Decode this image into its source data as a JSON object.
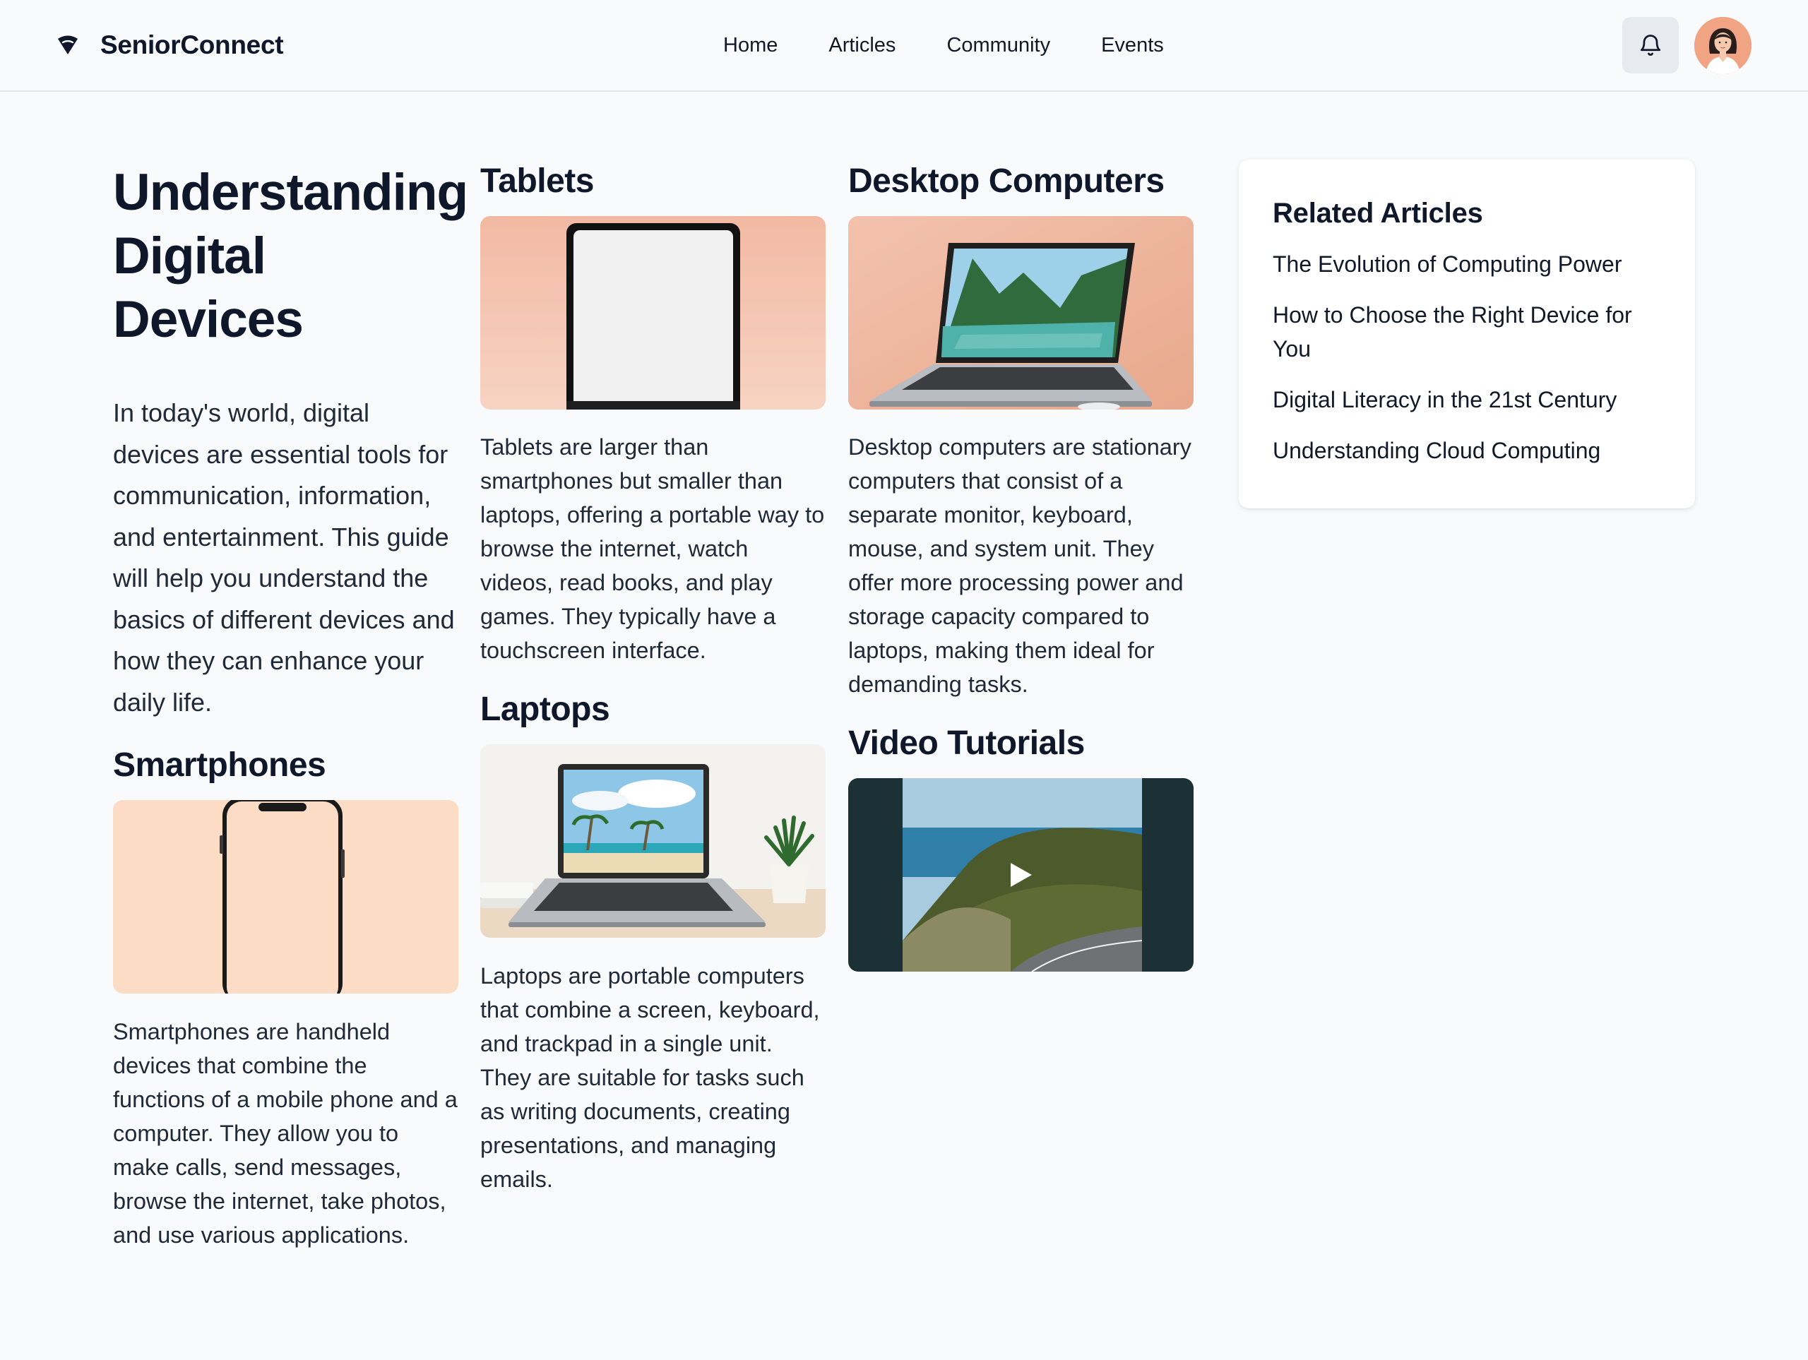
{
  "brand": {
    "name": "SeniorConnect",
    "logo_icon": "wifi-signal-icon"
  },
  "nav": {
    "items": [
      {
        "label": "Home"
      },
      {
        "label": "Articles"
      },
      {
        "label": "Community"
      },
      {
        "label": "Events"
      }
    ]
  },
  "header_actions": {
    "notifications_icon": "bell-icon",
    "avatar_icon": "user-avatar"
  },
  "intro": {
    "title": "Understanding Digital Devices",
    "text": "In today's world, digital devices are essential tools for communication, information, and entertainment. This guide will help you understand the basics of different devices and how they can enhance your daily life."
  },
  "sections": {
    "smartphones": {
      "title": "Smartphones",
      "description": "Smartphones are handheld devices that combine the functions of a mobile phone and a computer. They allow you to make calls, send messages, browse the internet, take photos, and use various applications."
    },
    "tablets": {
      "title": "Tablets",
      "description": "Tablets are larger than smartphones but smaller than laptops, offering a portable way to browse the internet, watch videos, read books, and play games. They typically have a touchscreen interface."
    },
    "laptops": {
      "title": "Laptops",
      "description": "Laptops are portable computers that combine a screen, keyboard, and trackpad in a single unit. They are suitable for tasks such as writing documents, creating presentations, and managing emails."
    },
    "desktops": {
      "title": "Desktop Computers",
      "description": "Desktop computers are stationary computers that consist of a separate monitor, keyboard, mouse, and system unit. They offer more processing power and storage capacity compared to laptops, making them ideal for demanding tasks."
    },
    "video": {
      "title": "Video Tutorials",
      "play_icon": "play-icon"
    }
  },
  "related": {
    "title": "Related Articles",
    "items": [
      {
        "label": "The Evolution of Computing Power"
      },
      {
        "label": "How to Choose the Right Device for You"
      },
      {
        "label": "Digital Literacy in the 21st Century"
      },
      {
        "label": "Understanding Cloud Computing"
      }
    ]
  }
}
